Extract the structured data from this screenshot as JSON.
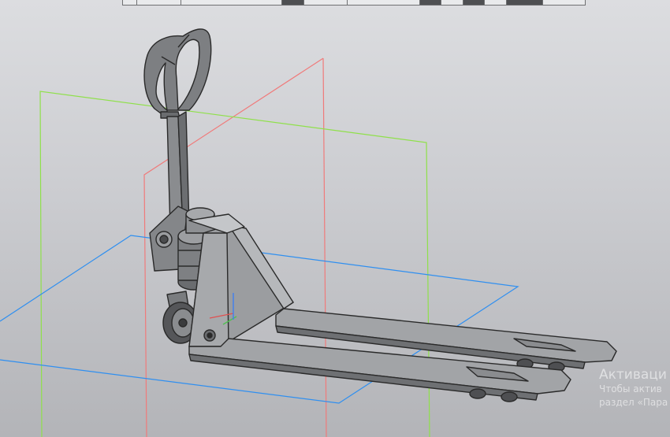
{
  "window": {
    "background_top": "#dcdde0",
    "background_bottom": "#b3b4b8"
  },
  "toolbar": {
    "cells": [
      {
        "name": "toolbar-cell-1",
        "state": "light",
        "w": 1
      },
      {
        "name": "toolbar-cell-2",
        "state": "light",
        "w": 3
      },
      {
        "name": "toolbar-cell-3",
        "state": "light",
        "w": 7
      },
      {
        "name": "toolbar-cell-4",
        "state": "active",
        "w": 1.5
      },
      {
        "name": "toolbar-cell-5",
        "state": "light",
        "w": 3
      },
      {
        "name": "toolbar-cell-6",
        "state": "light",
        "w": 5
      },
      {
        "name": "toolbar-cell-7",
        "state": "active",
        "w": 1.5
      },
      {
        "name": "toolbar-cell-8",
        "state": "light",
        "w": 1.5
      },
      {
        "name": "toolbar-cell-9",
        "state": "active",
        "w": 1.5
      },
      {
        "name": "toolbar-cell-10",
        "state": "light",
        "w": 1.5
      },
      {
        "name": "toolbar-cell-11",
        "state": "active",
        "w": 2.5
      },
      {
        "name": "toolbar-cell-12",
        "state": "light",
        "w": 3
      }
    ]
  },
  "scene": {
    "model": "hand-pallet-truck-icon",
    "planes": [
      {
        "name": "front-plane",
        "color": "#f07a7a"
      },
      {
        "name": "side-plane",
        "color": "#8fe04a"
      },
      {
        "name": "top-plane",
        "color": "#2f8ff0"
      }
    ],
    "origin_axes": [
      "#e05050",
      "#50c050",
      "#4080f0"
    ]
  },
  "watermark": {
    "title": "Активаци",
    "line1": "Чтобы актив",
    "line2": "раздел «Пара"
  }
}
